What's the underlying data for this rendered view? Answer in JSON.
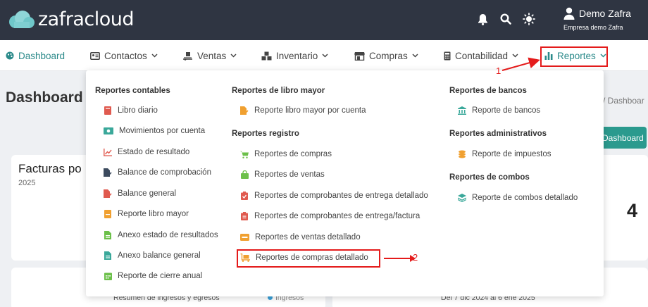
{
  "app": {
    "logo_text": "zafracloud",
    "user_name": "Demo Zafra",
    "user_company": "Empresa demo Zafra"
  },
  "nav": [
    {
      "label": "Dashboard"
    },
    {
      "label": "Contactos"
    },
    {
      "label": "Ventas"
    },
    {
      "label": "Inventario"
    },
    {
      "label": "Compras"
    },
    {
      "label": "Contabilidad"
    },
    {
      "label": "Reportes"
    }
  ],
  "page": {
    "title": "Dashboard",
    "breadcrumb": "/  Dashboar",
    "dashboard_button": "Dashboard",
    "card_title": "Facturas po",
    "card_year": "2025",
    "big_number": "4",
    "bottom_left": "Resumen de ingresos y egresos",
    "bottom_mid": "Ingresos",
    "bottom_right": "Del 7 dic 2024 al 6 ene 2025"
  },
  "menu": {
    "col1": {
      "heading": "Reportes contables",
      "items": [
        "Libro diario",
        "Movimientos por cuenta",
        "Estado de resultado",
        "Balance de comprobación",
        "Balance general",
        "Reporte libro mayor",
        "Anexo estado de resultados",
        "Anexo balance general",
        "Reporte de cierre anual"
      ]
    },
    "col2": {
      "heading1": "Reportes de libro mayor",
      "items1": [
        "Reporte libro mayor por cuenta"
      ],
      "heading2": "Reportes registro",
      "items2": [
        "Reportes de compras",
        "Reportes de ventas",
        "Reportes de comprobantes de entrega detallado",
        "Reportes de comprobantes de entrega/factura",
        "Reportes de ventas detallado",
        "Reportes de compras detallado"
      ]
    },
    "col3": {
      "heading1": "Reportes de bancos",
      "items1": [
        "Reporte de bancos"
      ],
      "heading2": "Reportes administrativos",
      "items2": [
        "Reporte de impuestos"
      ],
      "heading3": "Reportes de combos",
      "items3": [
        "Reporte de combos detallado"
      ]
    }
  },
  "annotations": {
    "label1": "1",
    "label2": "2"
  },
  "colors": {
    "topbar": "#2f3542",
    "accent": "#2b8a8a",
    "highlight": "#e41b1b"
  }
}
